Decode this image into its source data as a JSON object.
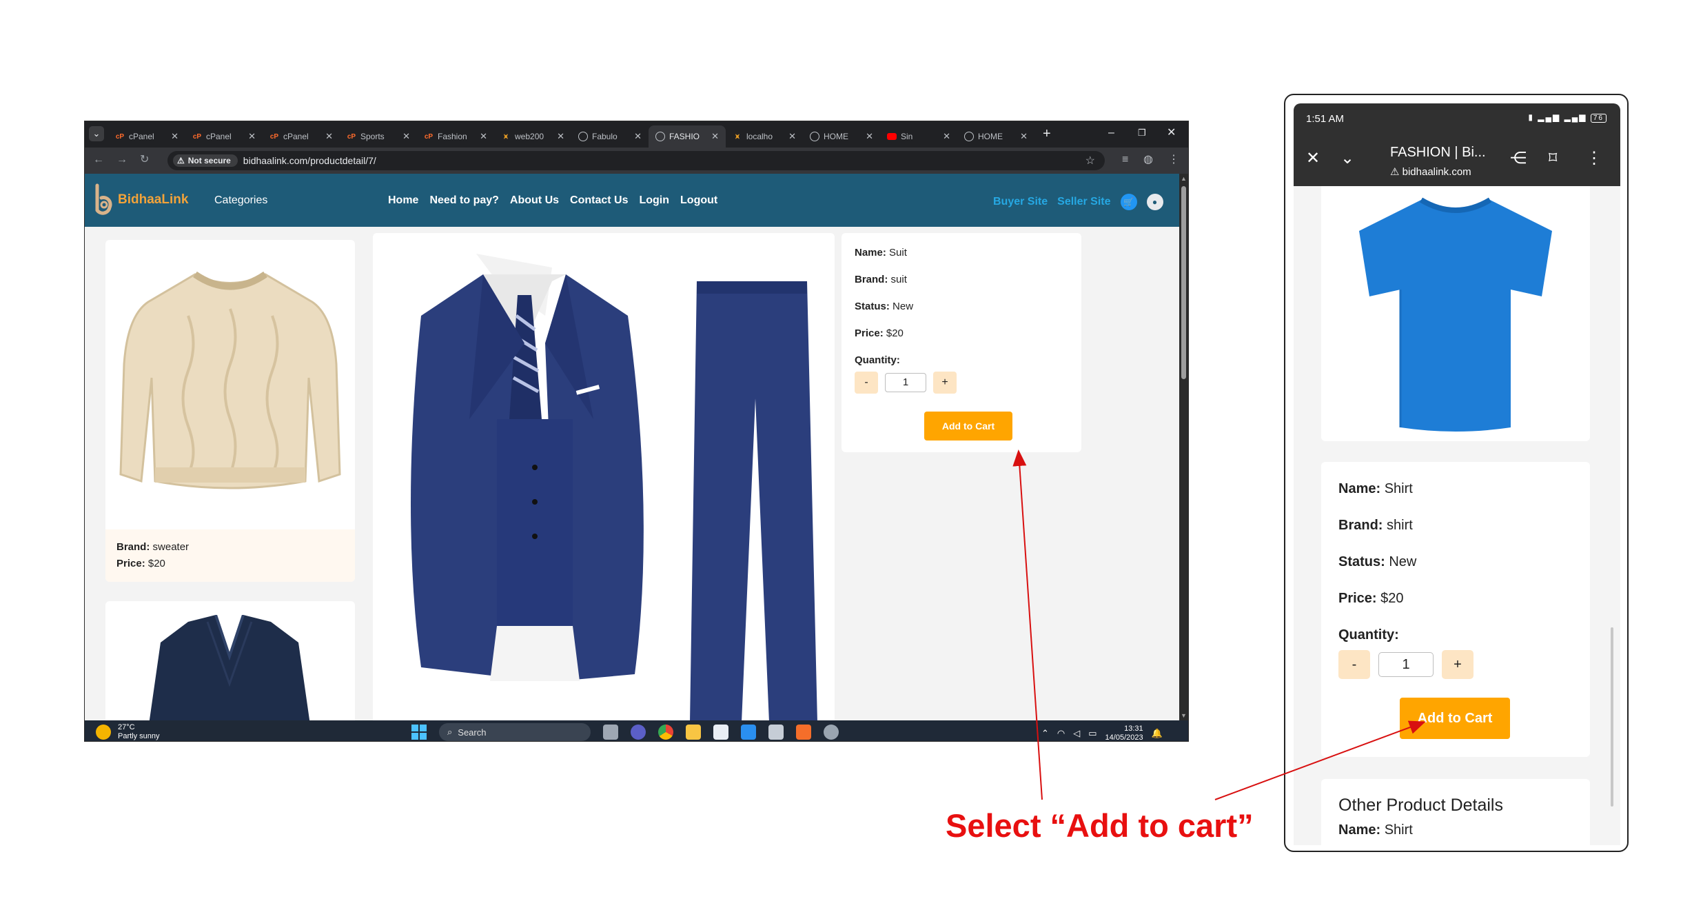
{
  "browser": {
    "tabs": [
      {
        "title": "cPanel",
        "icon": "cpanel"
      },
      {
        "title": "cPanel",
        "icon": "cpanel"
      },
      {
        "title": "cPanel",
        "icon": "cpanel"
      },
      {
        "title": "Sports",
        "icon": "cpanel"
      },
      {
        "title": "Fashion",
        "icon": "cpanel"
      },
      {
        "title": "web200",
        "icon": "lm"
      },
      {
        "title": "Fabulo",
        "icon": "globe"
      },
      {
        "title": "FASHIO",
        "icon": "globe",
        "active": true
      },
      {
        "title": "localho",
        "icon": "lm"
      },
      {
        "title": "HOME",
        "icon": "globe"
      },
      {
        "title": "Sin",
        "icon": "yt"
      },
      {
        "title": "HOME",
        "icon": "globe"
      }
    ],
    "security_label": "Not secure",
    "url": "bidhaalink.com/productdetail/7/"
  },
  "site": {
    "brand": "BidhaaLink",
    "categories_label": "Categories",
    "nav": [
      "Home",
      "Need to pay?",
      "About Us",
      "Contact Us",
      "Login",
      "Logout"
    ],
    "buyer_site": "Buyer Site",
    "seller_site": "Seller Site",
    "listing": {
      "brand_label": "Brand:",
      "brand_value": "sweater",
      "price_label": "Price:",
      "price_value": "$20"
    },
    "detail": {
      "name_label": "Name:",
      "name_value": "Suit",
      "brand_label": "Brand:",
      "brand_value": "suit",
      "status_label": "Status:",
      "status_value": "New",
      "price_label": "Price:",
      "price_value": "$20",
      "quantity_label": "Quantity:",
      "minus": "-",
      "plus": "+",
      "quantity_value": "1",
      "add_to_cart": "Add to Cart"
    }
  },
  "taskbar": {
    "temp": "27°C",
    "weather": "Partly sunny",
    "search": "Search",
    "time": "13:31",
    "date": "14/05/2023"
  },
  "mobile": {
    "time": "1:51 AM",
    "battery": "76",
    "title": "FASHION | Bi...",
    "host": "bidhaalink.com",
    "detail": {
      "name_label": "Name:",
      "name_value": "Shirt",
      "brand_label": "Brand:",
      "brand_value": "shirt",
      "status_label": "Status:",
      "status_value": "New",
      "price_label": "Price:",
      "price_value": "$20",
      "quantity_label": "Quantity:",
      "minus": "-",
      "plus": "+",
      "quantity_value": "1",
      "add_to_cart": "Add to Cart"
    },
    "other_heading": "Other Product Details",
    "other_name_label": "Name:",
    "other_name_value": "Shirt"
  },
  "instruction": "Select “Add to cart”",
  "colors": {
    "nav_bg": "#1e5b78",
    "accent": "#ffa500",
    "instruction": "#e81010"
  }
}
